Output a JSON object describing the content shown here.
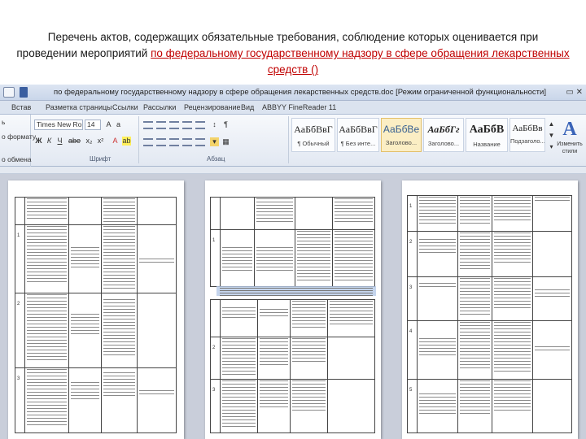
{
  "slide": {
    "title_part1": "Перечень актов, содержащих обязательные требования, соблюдение которых оценивается при проведении мероприятий ",
    "title_link": "по федеральному государственному надзору в сфере обращения лекарственных средств ()"
  },
  "word": {
    "window_title": "по федеральному государственному надзору в сфере обращения лекарственных средств.doc [Режим ограниченной функциональности]",
    "tabs": [
      {
        "label": "Встав"
      },
      {
        "label": "Разметка страницы"
      },
      {
        "label": "Ссылки"
      },
      {
        "label": "Рассылки"
      },
      {
        "label": "Рецензирование"
      },
      {
        "label": "Вид"
      },
      {
        "label": "ABBYY FineReader 11"
      }
    ],
    "left_strip": {
      "line1": "ь",
      "line2": "о формату",
      "line3": "о обмена"
    },
    "font_name": "Times New Ro",
    "font_size": "14",
    "group_font_label": "Шрифт",
    "group_paragraph_label": "Абзац",
    "styles": [
      {
        "sample": "АаБбВвГ",
        "name": "¶ Обычный",
        "selected": false
      },
      {
        "sample": "АаБбВвГ",
        "name": "¶ Без инте...",
        "selected": false
      },
      {
        "sample": "АаБбВе",
        "name": "Заголово...",
        "selected": true
      },
      {
        "sample": "АаБбГг",
        "name": "Заголово...",
        "selected": false
      },
      {
        "sample": "АаБбВ",
        "name": "Название",
        "selected": false
      },
      {
        "sample": "АаБбВв",
        "name": "Подзаголо...",
        "selected": false
      }
    ],
    "change_styles": {
      "line1": "Изменить",
      "line2": "стили"
    },
    "document": {
      "page1": {
        "row_numbers": [
          "1",
          "2",
          "3"
        ]
      },
      "page2": {
        "row_numbers": [
          "1",
          "2",
          "3"
        ]
      },
      "page3": {
        "row_numbers": [
          "1",
          "2",
          "3",
          "4",
          "5"
        ]
      }
    }
  }
}
